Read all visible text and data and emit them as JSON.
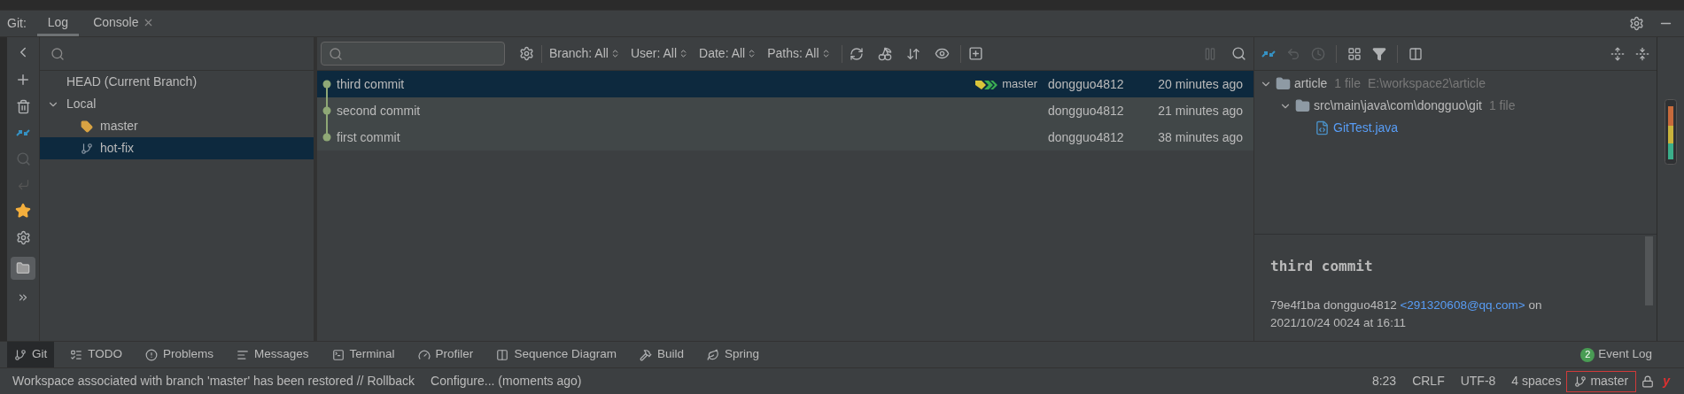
{
  "tool_window": {
    "title": "Git:",
    "tabs": [
      {
        "label": "Log",
        "selected": true,
        "closable": false
      },
      {
        "label": "Console",
        "selected": false,
        "closable": true
      }
    ]
  },
  "branches": {
    "items": [
      {
        "label": "HEAD (Current Branch)",
        "kind": "head",
        "selected": false
      },
      {
        "label": "Local",
        "kind": "group",
        "expanded": true,
        "selected": false,
        "children": [
          {
            "label": "master",
            "kind": "tag",
            "selected": false
          },
          {
            "label": "hot-fix",
            "kind": "branch",
            "selected": true
          }
        ]
      }
    ]
  },
  "log": {
    "filters": [
      "Branch: All",
      "User: All",
      "Date: All",
      "Paths: All"
    ],
    "commits": [
      {
        "message": "third commit",
        "ref": "master",
        "author": "dongguo4812",
        "time": "20 minutes ago",
        "selected": true
      },
      {
        "message": "second commit",
        "author": "dongguo4812",
        "time": "21 minutes ago",
        "selected": false
      },
      {
        "message": "first commit",
        "author": "dongguo4812",
        "time": "38 minutes ago",
        "selected": false
      }
    ]
  },
  "changes": {
    "tree": [
      {
        "name": "article",
        "kind": "module",
        "count": "1 file",
        "path": "E:\\workspace2\\article",
        "expanded": true,
        "children": [
          {
            "name": "src\\main\\java\\com\\dongguo\\git",
            "kind": "folder",
            "count": "1 file",
            "expanded": true,
            "children": [
              {
                "name": "GitTest.java",
                "kind": "file"
              }
            ]
          }
        ]
      }
    ]
  },
  "details": {
    "title": "third commit",
    "hash": "79e4f1ba",
    "author": "dongguo4812",
    "email": "<291320608@qq.com>",
    "on": "on",
    "date": "2021/10/24 0024 at 16:11"
  },
  "bottom_tools": [
    {
      "label": "Git",
      "selected": true
    },
    {
      "label": "TODO",
      "selected": false
    },
    {
      "label": "Problems",
      "selected": false
    },
    {
      "label": "Messages",
      "selected": false
    },
    {
      "label": "Terminal",
      "selected": false
    },
    {
      "label": "Profiler",
      "selected": false
    },
    {
      "label": "Sequence Diagram",
      "selected": false
    },
    {
      "label": "Build",
      "selected": false
    },
    {
      "label": "Spring",
      "selected": false
    }
  ],
  "event_log": {
    "count": "2",
    "label": "Event Log"
  },
  "status_bar": {
    "message": "Workspace associated with branch 'master' has been restored // Rollback",
    "action": "Configure... (moments ago)",
    "position": "8:23",
    "line_separator": "CRLF",
    "encoding": "UTF-8",
    "indent": "4 spaces",
    "branch": "master",
    "plugin": "y"
  }
}
